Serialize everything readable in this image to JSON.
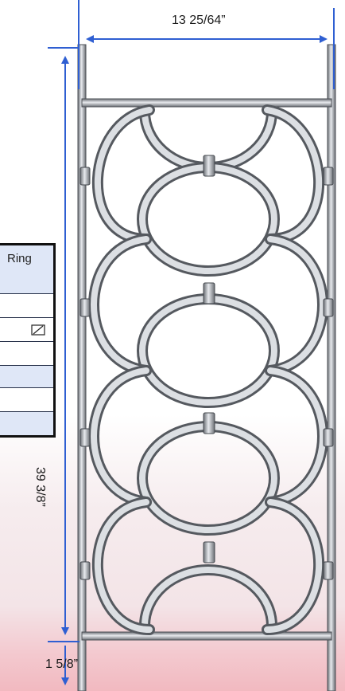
{
  "dimensions": {
    "width": "13 25/64”",
    "height": "39 3/8”",
    "bottom_rail_height": "1 5/8”"
  },
  "table_fragment": {
    "header_text": "Ring",
    "checkbox_icon": "empty-set-icon"
  },
  "colors": {
    "dimension_line": "#2f5fd2",
    "metal_dark": "#55595f",
    "metal_light": "#dcdfe3",
    "table_row_blue": "#dfe7f7",
    "bottom_band": "#f2b9c0"
  }
}
